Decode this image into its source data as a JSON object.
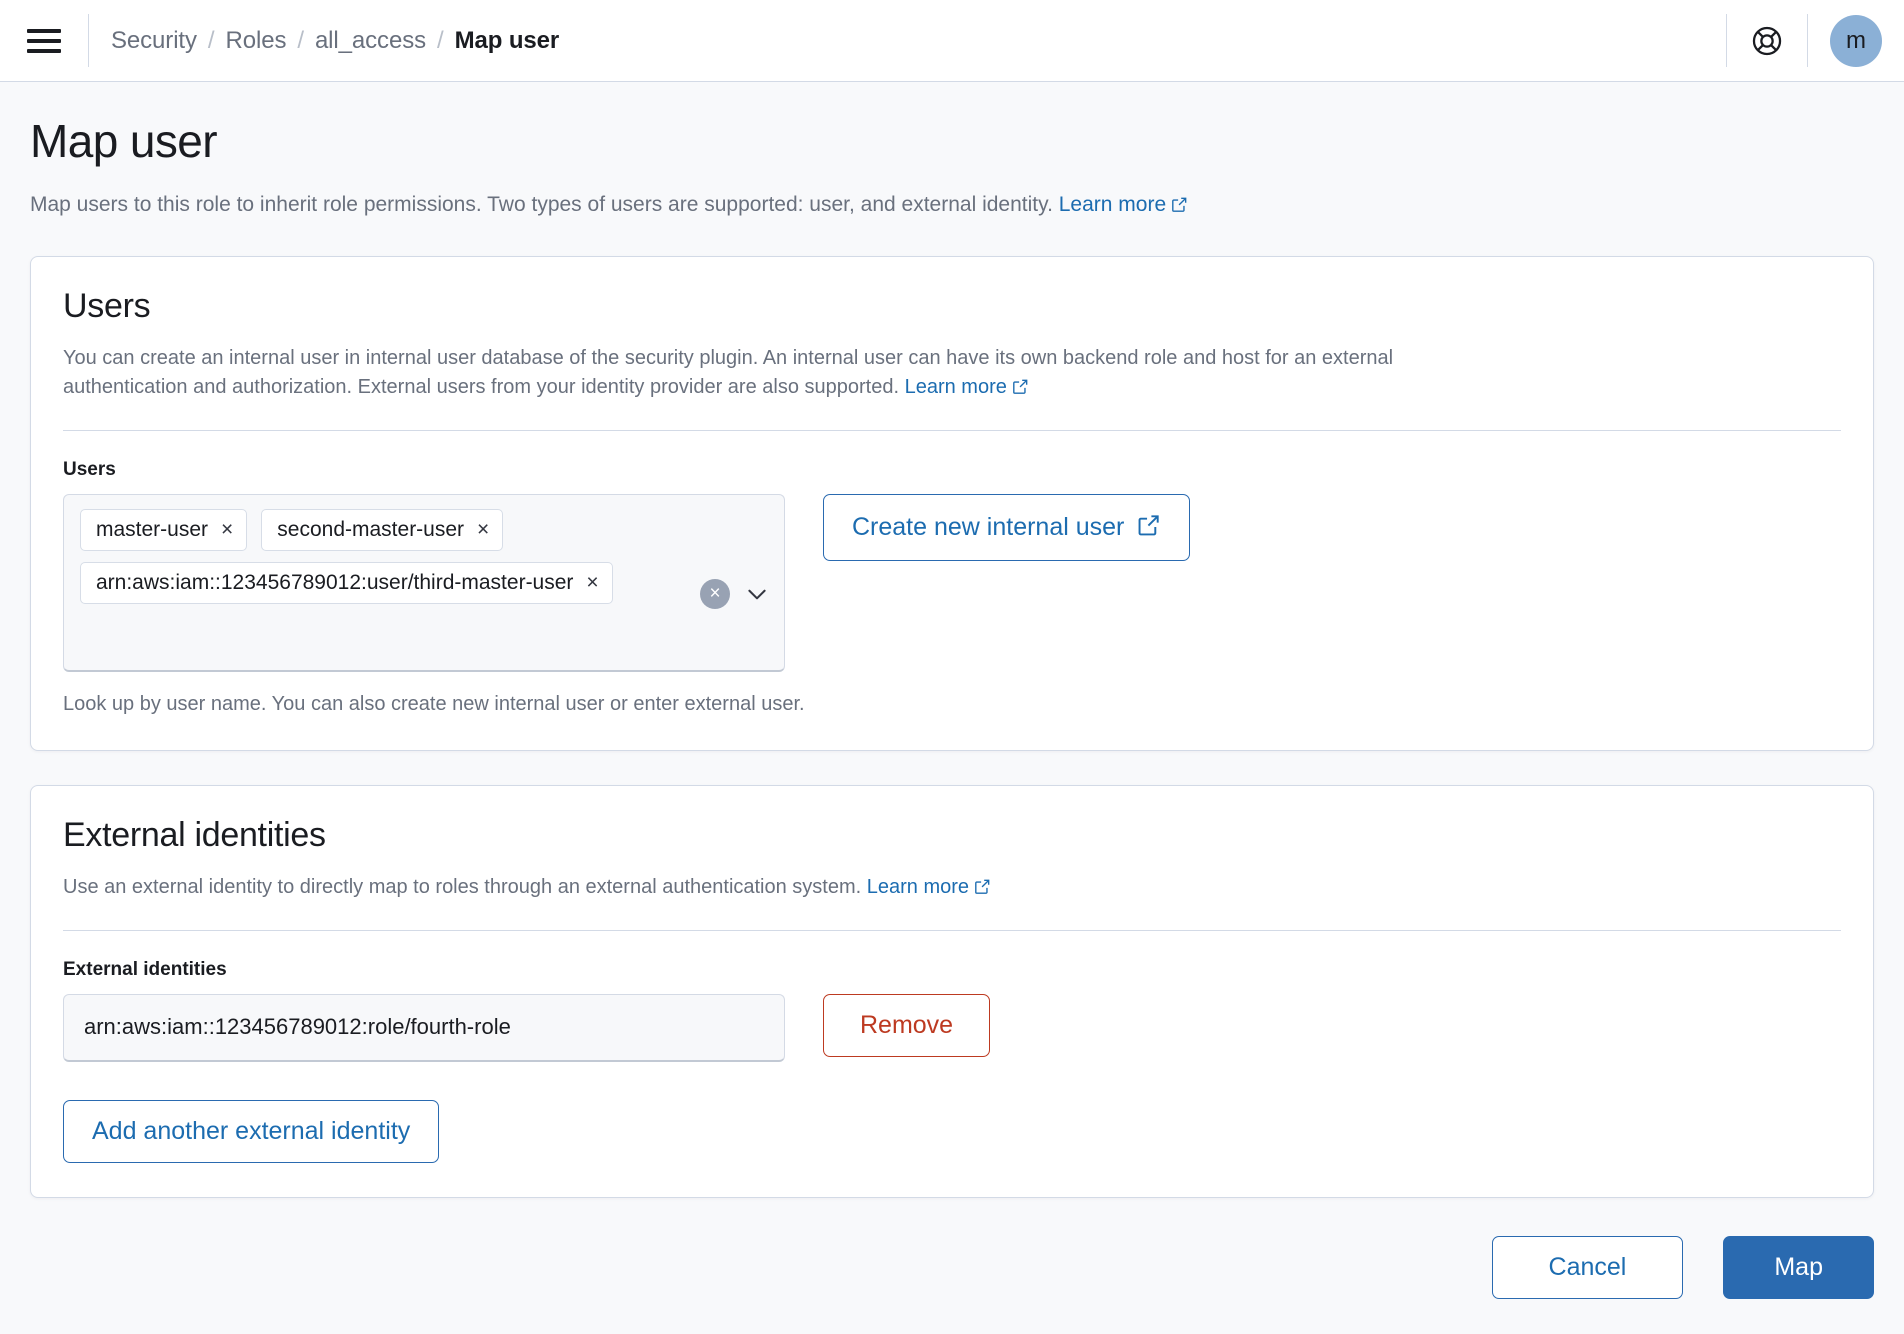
{
  "header": {
    "menu_icon": "hamburger-menu-icon",
    "breadcrumb": [
      {
        "label": "Security",
        "current": false
      },
      {
        "label": "Roles",
        "current": false
      },
      {
        "label": "all_access",
        "current": false
      },
      {
        "label": "Map user",
        "current": true
      }
    ],
    "separator": "/",
    "help_icon": "life-ring-help-icon",
    "avatar_initial": "m"
  },
  "page": {
    "title": "Map user",
    "description": "Map users to this role to inherit role permissions. Two types of users are supported: user, and external identity.",
    "learn_more": "Learn more"
  },
  "users_card": {
    "heading": "Users",
    "description": "You can create an internal user in internal user database of the security plugin. An internal user can have its own backend role and host for an external authentication and authorization. External users from your identity provider are also supported.",
    "learn_more": "Learn more",
    "field_label": "Users",
    "pills": [
      {
        "label": "master-user",
        "remove": "×"
      },
      {
        "label": "second-master-user",
        "remove": "×"
      },
      {
        "label": "arn:aws:iam::123456789012:user/third-master-user",
        "remove": "×"
      }
    ],
    "clear_all": "×",
    "help_text": "Look up by user name. You can also create new internal user or enter external user.",
    "create_button": "Create new internal user"
  },
  "external_card": {
    "heading": "External identities",
    "description": "Use an external identity to directly map to roles through an external authentication system.",
    "learn_more": "Learn more",
    "field_label": "External identities",
    "identity_value": "arn:aws:iam::123456789012:role/fourth-role",
    "identity_placeholder": "",
    "remove_button": "Remove",
    "add_button": "Add another external identity"
  },
  "footer": {
    "cancel_label": "Cancel",
    "map_label": "Map"
  },
  "colors": {
    "link": "#1c6cb0",
    "primary": "#2a6ab0",
    "danger": "#bd3a21",
    "avatar": "#8bb0d6",
    "page_bg": "#f8f9fb",
    "border": "#d3dae6"
  }
}
